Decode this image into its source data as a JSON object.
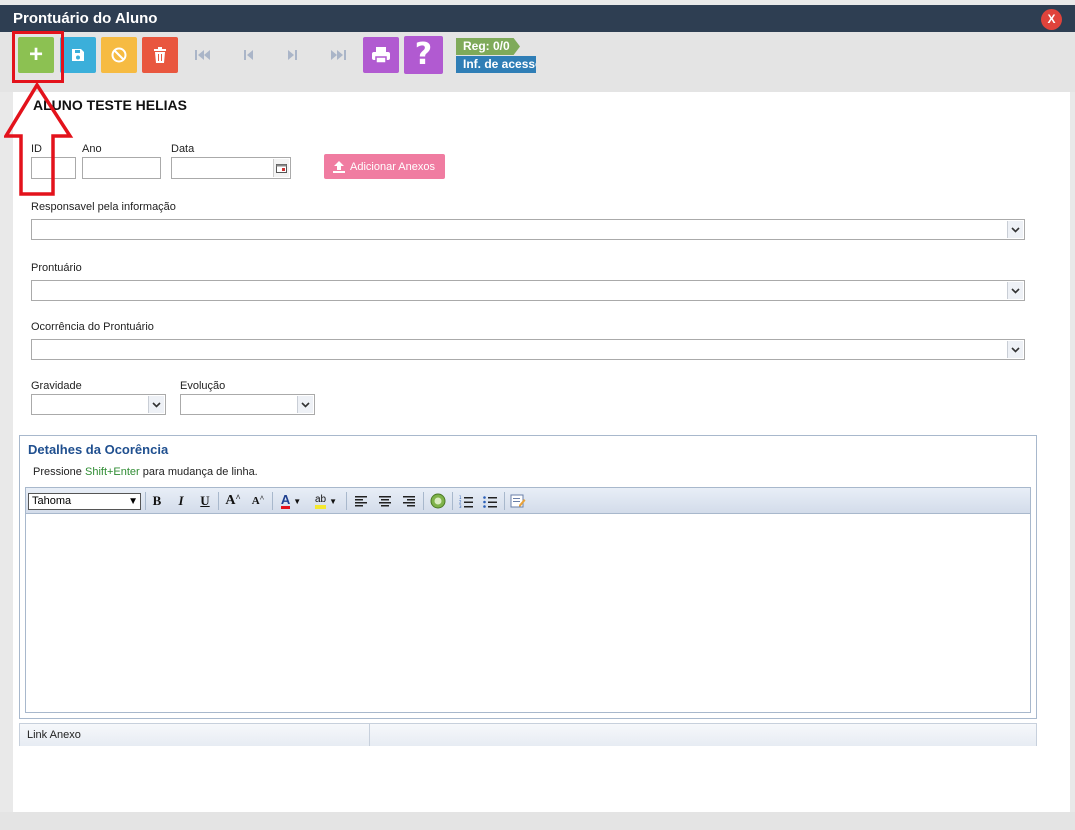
{
  "window": {
    "title": "Prontuário do Aluno",
    "close_label": "X"
  },
  "toolbar": {
    "add_label": "+",
    "reg_label": "Reg: 0/0",
    "access_info_label": "Inf. de acesso"
  },
  "form": {
    "student_name": "ALUNO TESTE HELIAS",
    "id_label": "ID",
    "id_value": "",
    "year_label": "Ano",
    "year_value": "",
    "date_label": "Data",
    "date_value": "",
    "attach_label": "Adicionar Anexos",
    "responsible_label": "Responsavel pela informação",
    "responsible_value": "",
    "record_label": "Prontuário",
    "record_value": "",
    "occurrence_label": "Ocorrência do Prontuário",
    "occurrence_value": "",
    "severity_label": "Gravidade",
    "severity_value": "",
    "evolution_label": "Evolução",
    "evolution_value": ""
  },
  "details": {
    "title": "Detalhes da Ocorência",
    "hint_prefix": "Pressione ",
    "hint_keys": "Shift+Enter",
    "hint_suffix": " para mudança de linha.",
    "font_name": "Tahoma",
    "bold_label": "B",
    "italic_label": "I",
    "underline_label": "U",
    "grow_label": "A",
    "shrink_label": "A",
    "font_color_label": "A",
    "highlight_label": "ab",
    "body_text": ""
  },
  "attachments": {
    "column_header": "Link Anexo"
  },
  "colors": {
    "titlebar": "#2e3e52",
    "add_button": "#8cc152",
    "save_button": "#3bafda",
    "cancel_button": "#f6bb42",
    "delete_button": "#e9573f",
    "print_button": "#b15ad1",
    "help_button": "#b15ad1",
    "highlight": "#e3121b"
  },
  "icons": {
    "add": "plus-icon",
    "save": "floppy-icon",
    "cancel": "ban-icon",
    "delete": "trash-icon",
    "first": "first-icon",
    "prev": "prev-icon",
    "next": "next-icon",
    "last": "last-icon",
    "print": "printer-icon",
    "help": "question-icon"
  }
}
